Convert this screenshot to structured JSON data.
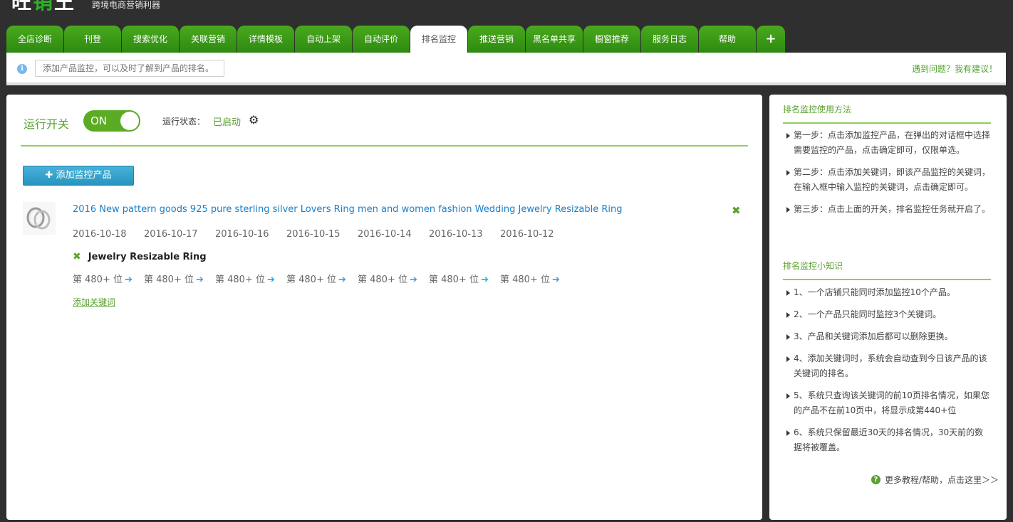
{
  "header": {
    "logo_part1": "旺",
    "logo_part2": "销",
    "logo_part3": "王",
    "tagline": "跨境电商营销利器"
  },
  "nav": {
    "tabs": [
      {
        "label": "全店诊断"
      },
      {
        "label": "刊登"
      },
      {
        "label": "搜索优化"
      },
      {
        "label": "关联营销"
      },
      {
        "label": "详情模板"
      },
      {
        "label": "自动上架"
      },
      {
        "label": "自动评价"
      },
      {
        "label": "排名监控",
        "active": true
      },
      {
        "label": "推送营销"
      },
      {
        "label": "黑名单共享"
      },
      {
        "label": "橱窗推荐"
      },
      {
        "label": "服务日志"
      },
      {
        "label": "帮助"
      }
    ],
    "plus_label": "+"
  },
  "infobar": {
    "icon": "info-icon",
    "hint": "添加产品监控，可以及时了解到产品的排名。",
    "feedback": "遇到问题？我有建议！"
  },
  "main": {
    "switch_label": "运行开关",
    "toggle_state": "ON",
    "status_label": "运行状态：",
    "status_value": "已启动",
    "add_product_label": "添加监控产品",
    "product": {
      "title": "2016 New pattern goods 925 pure sterling silver Lovers Ring men and women fashion Wedding Jewelry Resizable Ring",
      "dates": [
        "2016-10-18",
        "2016-10-17",
        "2016-10-16",
        "2016-10-15",
        "2016-10-14",
        "2016-10-13",
        "2016-10-12"
      ],
      "keyword": "Jewelry Resizable Ring",
      "ranks": [
        "第 480+ 位",
        "第 480+ 位",
        "第 480+ 位",
        "第 480+ 位",
        "第 480+ 位",
        "第 480+ 位",
        "第 480+ 位"
      ],
      "add_keyword_label": "添加关键词"
    }
  },
  "side": {
    "usage_title": "排名监控使用方法",
    "usage_steps": [
      "第一步：点击添加监控产品，在弹出的对话框中选择需要监控的产品，点击确定即可，仅限单选。",
      "第二步：点击添加关键词，即该产品监控的关键词，在输入框中输入监控的关键词，点击确定即可。",
      "第三步：点击上面的开关，排名监控任务就开启了。"
    ],
    "tips_title": "排名监控小知识",
    "tips": [
      "1、一个店铺只能同时添加监控10个产品。",
      "2、一个产品只能同时监控3个关键词。",
      "3、产品和关键词添加后都可以删除更换。",
      "4、添加关键词时，系统会自动查到今日该产品的该关键词的排名。",
      "5、系统只查询该关键词的前10页排名情况，如果您的产品不在前10页中，将显示成第440+位",
      "6、系统只保留最近30天的排名情况，30天前的数据将被覆盖。"
    ],
    "help_link": "更多教程/帮助，点击这里＞＞"
  },
  "colors": {
    "brand_green": "#4aa91e",
    "accent_green": "#5aa12f",
    "link_blue": "#1a7fc7",
    "button_blue": "#2795c0",
    "page_bg": "#2f2f2f"
  }
}
